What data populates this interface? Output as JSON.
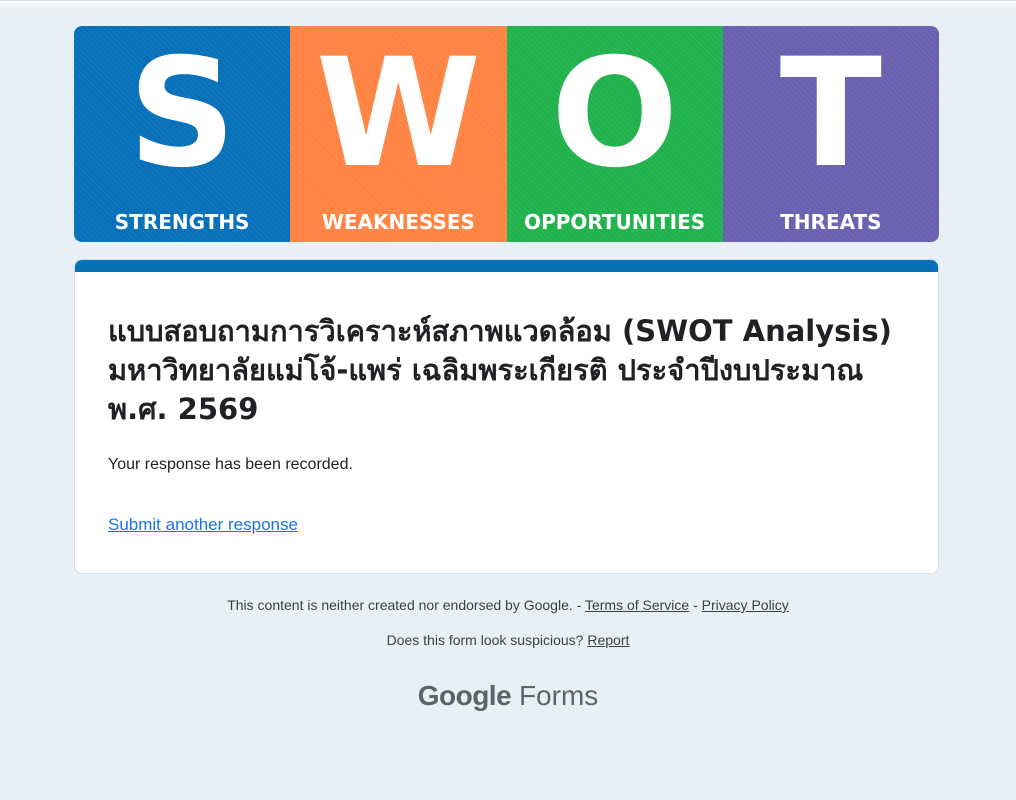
{
  "banner": {
    "panels": [
      {
        "letter": "S",
        "word": "STRENGTHS",
        "color": "#0670b8"
      },
      {
        "letter": "W",
        "word": "WEAKNESSES",
        "color": "#ff8444"
      },
      {
        "letter": "O",
        "word": "OPPORTUNITIES",
        "color": "#22b24c"
      },
      {
        "letter": "T",
        "word": "THREATS",
        "color": "#6a60b0"
      }
    ]
  },
  "form": {
    "accent_color": "#0670b8",
    "title": "แบบสอบถามการวิเคราะห์สภาพแวดล้อม (SWOT Analysis) มหาวิทยาลัยแม่โจ้-แพร่ เฉลิมพระเกียรติ ประจำปีงบประมาณ พ.ศ. 2569",
    "confirmation": "Your response has been recorded.",
    "submit_another": "Submit another response"
  },
  "footer": {
    "disclaimer": "This content is neither created nor endorsed by Google.",
    "separator1": " - ",
    "terms": "Terms of Service",
    "separator2": " - ",
    "privacy": "Privacy Policy",
    "suspicious": "Does this form look suspicious?",
    "report": "Report",
    "brand_google": "Google",
    "brand_forms": "Forms"
  }
}
